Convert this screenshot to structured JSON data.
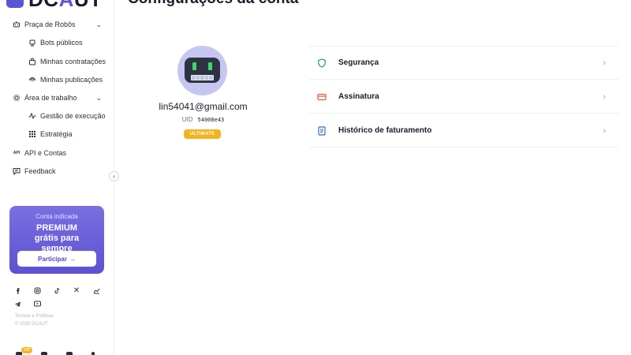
{
  "brand": {
    "name_prefix": "DC",
    "name_accent": "A",
    "name_suffix": "UT"
  },
  "colors": {
    "accent": "#5b54d6",
    "tier_badge": "#f4b21c",
    "shield": "#1a9a6c",
    "card": "#e5573d",
    "book": "#2f6fb2"
  },
  "sidebar": {
    "items": [
      {
        "label": "Praça de Robôs",
        "icon": "robot-icon",
        "expandable": true
      },
      {
        "label": "Bots públicos",
        "icon": "bot-icon",
        "child": true
      },
      {
        "label": "Minhas contratações",
        "icon": "bag-icon",
        "child": true
      },
      {
        "label": "Minhas publicações",
        "icon": "broadcast-icon",
        "child": true
      },
      {
        "label": "Área de trabalho",
        "icon": "gear-icon",
        "expandable": true
      },
      {
        "label": "Gestão de execução",
        "icon": "activity-icon",
        "child": true
      },
      {
        "label": "Estratégia",
        "icon": "grid-icon",
        "child": true
      },
      {
        "label": "API e Contas",
        "icon": "api-icon"
      },
      {
        "label": "Feedback",
        "icon": "message-icon"
      }
    ],
    "promo": {
      "eyebrow": "Conta indicada",
      "title": "PREMIUM grátis para sempre",
      "button": "Participar"
    },
    "social": [
      "facebook-icon",
      "instagram-icon",
      "tiktok-icon",
      "x-icon",
      "chart-icon",
      "telegram-icon",
      "youtube-icon"
    ],
    "legal": {
      "terms": "Termos e Políticas",
      "copyright": "© 2025 DCAUT"
    },
    "vip_badge": "VIP"
  },
  "main": {
    "title": "Configurações da conta",
    "profile": {
      "email": "lin54041@gmail.com",
      "uid_label": "UID",
      "uid_value": "54008e43",
      "tier": "ULTIMATE"
    },
    "settings": [
      {
        "label": "Segurança",
        "icon": "shield-icon"
      },
      {
        "label": "Assinatura",
        "icon": "credit-card-icon"
      },
      {
        "label": "Histórico de faturamento",
        "icon": "book-icon"
      }
    ]
  }
}
